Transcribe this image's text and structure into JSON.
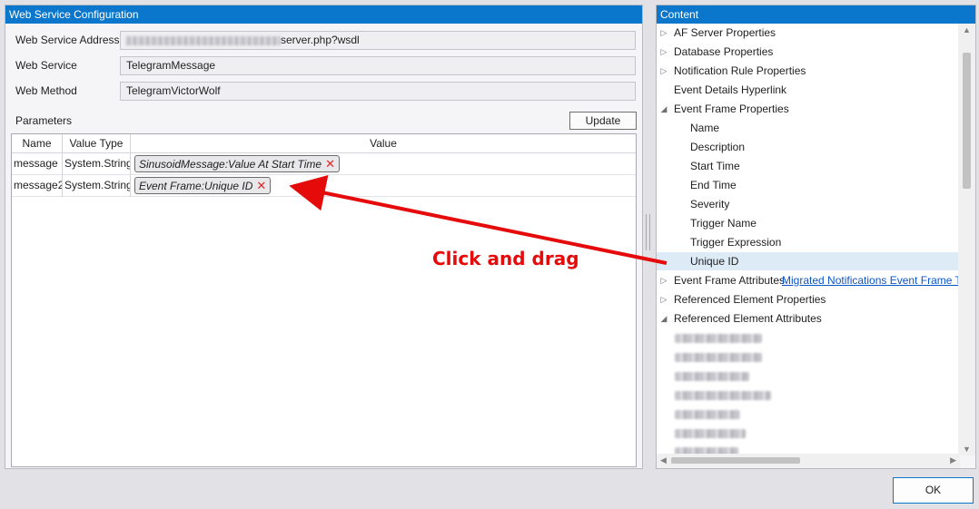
{
  "web_service_panel": {
    "title": "Web Service Configuration",
    "address_label": "Web Service Address",
    "address_value": "server.php?wsdl",
    "service_label": "Web Service",
    "service_value": "TelegramMessage",
    "method_label": "Web Method",
    "method_value": "TelegramVictorWolf",
    "parameters_label": "Parameters",
    "update_label": "Update",
    "columns": [
      "Name",
      "Value Type",
      "Value"
    ],
    "rows": [
      {
        "name": "message",
        "type": "System.String",
        "value": "SinusoidMessage:Value At Start Time"
      },
      {
        "name": "message2",
        "type": "System.String",
        "value": "Event Frame:Unique ID"
      }
    ]
  },
  "content_panel": {
    "title": "Content",
    "items": [
      {
        "label": "AF Server Properties",
        "state": "collapsed"
      },
      {
        "label": "Database Properties",
        "state": "collapsed"
      },
      {
        "label": "Notification Rule Properties",
        "state": "collapsed"
      },
      {
        "label": "Event Details Hyperlink",
        "state": "leaf"
      },
      {
        "label": "Event Frame Properties",
        "state": "expanded"
      },
      {
        "label": "Name",
        "state": "child"
      },
      {
        "label": "Description",
        "state": "child"
      },
      {
        "label": "Start Time",
        "state": "child"
      },
      {
        "label": "End Time",
        "state": "child"
      },
      {
        "label": "Severity",
        "state": "child"
      },
      {
        "label": "Trigger Name",
        "state": "child"
      },
      {
        "label": "Trigger Expression",
        "state": "child"
      },
      {
        "label": "Unique ID",
        "state": "child-selected"
      },
      {
        "label": "Event Frame Attributes",
        "state": "collapsed",
        "link": "Migrated Notifications Event Frame Te"
      },
      {
        "label": "Referenced Element Properties",
        "state": "collapsed"
      },
      {
        "label": "Referenced Element Attributes",
        "state": "expanded"
      }
    ]
  },
  "annotation": {
    "text": "Click and drag",
    "color": "#e60b0b"
  },
  "ok_label": "OK",
  "colors": {
    "title_bar": "#0b77cc",
    "selection": "#ddebf7",
    "link": "#0b56c9"
  }
}
